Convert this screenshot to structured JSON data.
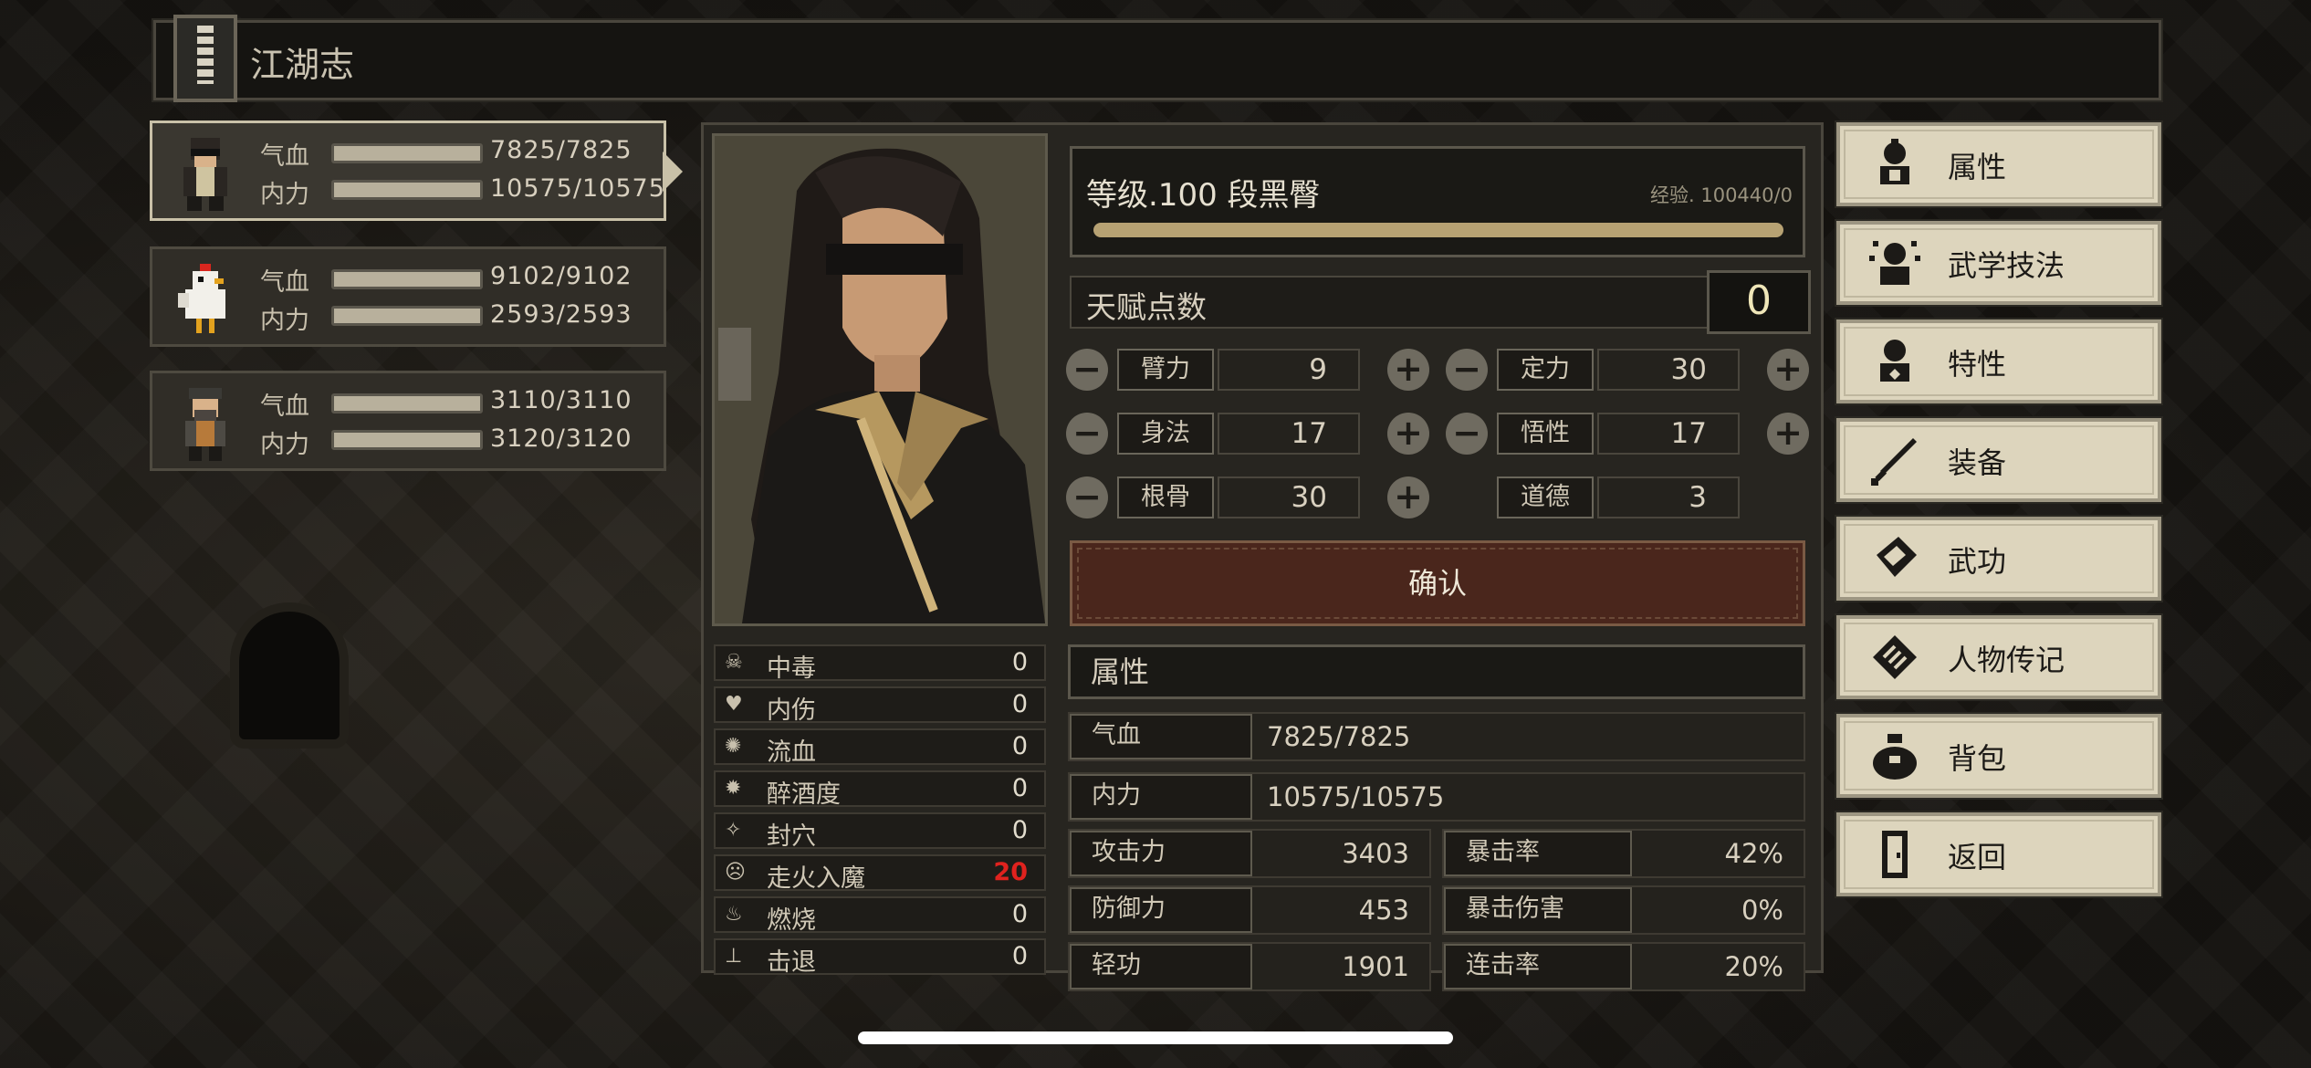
{
  "app": {
    "title": "江湖志"
  },
  "party": [
    {
      "qi_label": "气血",
      "qi": "7825/7825",
      "nl_label": "内力",
      "nl": "10575/10575"
    },
    {
      "qi_label": "气血",
      "qi": "9102/9102",
      "nl_label": "内力",
      "nl": "2593/2593"
    },
    {
      "qi_label": "气血",
      "qi": "3110/3110",
      "nl_label": "内力",
      "nl": "3120/3120"
    }
  ],
  "status": [
    {
      "name": "中毒",
      "value": "0",
      "icon": "skull-icon"
    },
    {
      "name": "内伤",
      "value": "0",
      "icon": "broken-heart-icon"
    },
    {
      "name": "流血",
      "value": "0",
      "icon": "blood-icon"
    },
    {
      "name": "醉酒度",
      "value": "0",
      "icon": "drunk-icon"
    },
    {
      "name": "封穴",
      "value": "0",
      "icon": "acupoint-icon"
    },
    {
      "name": "走火入魔",
      "value": "20",
      "icon": "demon-icon"
    },
    {
      "name": "燃烧",
      "value": "0",
      "icon": "fire-icon"
    },
    {
      "name": "击退",
      "value": "0",
      "icon": "knockback-icon"
    }
  ],
  "level": {
    "text": "等级.100 段黑臀",
    "exp": "经验. 100440/0"
  },
  "talent": {
    "label": "天赋点数",
    "value": "0"
  },
  "attributes": {
    "biliti": {
      "label": "臂力",
      "value": "9"
    },
    "dingli": {
      "label": "定力",
      "value": "30"
    },
    "shenfa": {
      "label": "身法",
      "value": "17"
    },
    "wuxing": {
      "label": "悟性",
      "value": "17"
    },
    "gengu": {
      "label": "根骨",
      "value": "30"
    },
    "daode": {
      "label": "道德",
      "value": "3"
    }
  },
  "confirm": "确认",
  "props": {
    "header": "属性",
    "qixue": {
      "label": "气血",
      "value": "7825/7825"
    },
    "neili": {
      "label": "内力",
      "value": "10575/10575"
    },
    "gongji": {
      "label": "攻击力",
      "value": "3403"
    },
    "baoji": {
      "label": "暴击率",
      "value": "42%"
    },
    "fangyu": {
      "label": "防御力",
      "value": "453"
    },
    "baoshang": {
      "label": "暴击伤害",
      "value": "0%"
    },
    "qinggong": {
      "label": "轻功",
      "value": "1901"
    },
    "lianji": {
      "label": "连击率",
      "value": "20%"
    }
  },
  "nav": [
    {
      "label": "属性",
      "icon": "attribute-icon"
    },
    {
      "label": "武学技法",
      "icon": "martial-skill-icon"
    },
    {
      "label": "特性",
      "icon": "trait-icon"
    },
    {
      "label": "装备",
      "icon": "sword-icon"
    },
    {
      "label": "武功",
      "icon": "book-icon"
    },
    {
      "label": "人物传记",
      "icon": "scroll-icon"
    },
    {
      "label": "背包",
      "icon": "bag-icon"
    },
    {
      "label": "返回",
      "icon": "exit-door-icon"
    }
  ]
}
